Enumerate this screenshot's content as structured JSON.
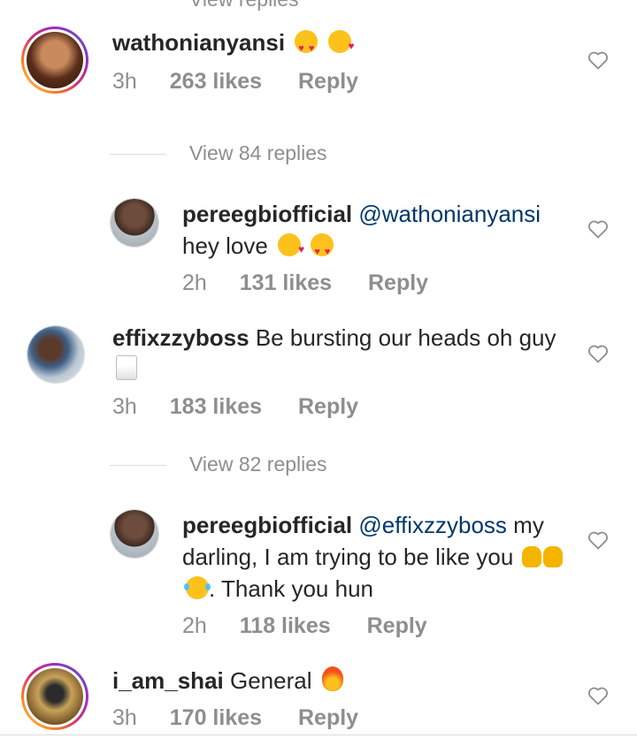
{
  "top_partial": {
    "text": "View replies"
  },
  "comments": [
    {
      "username": "wathonianyansi",
      "text": "",
      "emojis": [
        "heart-eyes-emoji",
        "smiling-face-with-hearts-emoji"
      ],
      "time": "3h",
      "likes": "263 likes",
      "reply": "Reply"
    },
    {
      "username": "pereegbiofficial",
      "mention": "@wathonianyansi",
      "text": "hey love",
      "emojis": [
        "hugging-face-emoji",
        "heart-eyes-emoji"
      ],
      "time": "2h",
      "likes": "131 likes",
      "reply": "Reply"
    },
    {
      "username": "effixzzyboss",
      "text": "Be bursting our heads oh guy",
      "emojis": [
        "clinking-glasses-emoji"
      ],
      "time": "3h",
      "likes": "183 likes",
      "reply": "Reply"
    },
    {
      "username": "pereegbiofficial",
      "mention": "@effixzzyboss",
      "text": "my darling, I am trying to be like you",
      "text_after": ". Thank you hun",
      "emojis": [
        "raising-hands-emoji",
        "raising-hands-emoji",
        "tears-of-joy-emoji"
      ],
      "time": "2h",
      "likes": "118 likes",
      "reply": "Reply"
    },
    {
      "username": "i_am_shai",
      "text": "General",
      "emojis": [
        "fire-emoji"
      ],
      "time": "3h",
      "likes": "170 likes",
      "reply": "Reply"
    }
  ],
  "view_replies": [
    {
      "label": "View 84 replies"
    },
    {
      "label": "View 82 replies"
    }
  ],
  "icons": {
    "like": "heart-outline-icon"
  },
  "colors": {
    "text": "#262626",
    "secondary": "#8e8e8e",
    "mention": "#00376b",
    "divider": "#dbdbdb"
  }
}
